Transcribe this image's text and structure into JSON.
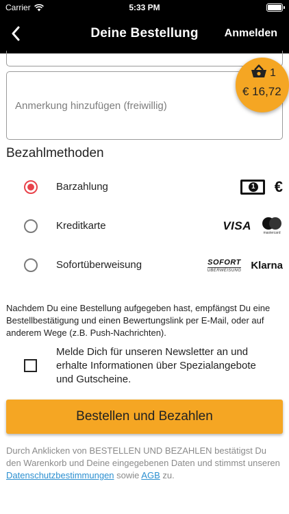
{
  "status_bar": {
    "carrier": "Carrier",
    "time": "5:33 PM"
  },
  "nav": {
    "title": "Deine Bestellung",
    "login": "Anmelden"
  },
  "basket": {
    "count": "1",
    "price": "€ 16,72"
  },
  "note_field": {
    "placeholder": "Anmerkung hinzufügen (freiwillig)"
  },
  "payment": {
    "title": "Bezahlmethoden",
    "methods": [
      {
        "label": "Barzahlung",
        "selected": true
      },
      {
        "label": "Kreditkarte",
        "selected": false
      },
      {
        "label": "Sofortüberweisung",
        "selected": false
      }
    ],
    "logos": {
      "euro": "€",
      "visa": "VISA",
      "mastercard": "mastercard",
      "sofort": "SOFORT",
      "sofort_sub": "ÜBERWEISUNG",
      "klarna": "Klarna"
    }
  },
  "info_text": "Nachdem Du eine Bestellung aufgegeben hast, empfängst Du eine Bestellbestätigung und einen Bewertungslink per E-Mail, oder auf anderem Wege (z.B. Push-Nachrichten).",
  "newsletter": {
    "label": "Melde Dich für unseren Newsletter an und erhalte Informationen über Spezialangebote und Gutscheine.",
    "checked": false
  },
  "order_button": "Bestellen und Bezahlen",
  "legal": {
    "text_before": "Durch Anklicken von BESTELLEN UND BEZAHLEN bestätigst Du den Warenkorb und Deine eingegebenen Daten und stimmst unseren ",
    "privacy_link": "Datenschutzbestimmungen",
    "text_middle": " sowie ",
    "terms_link": "AGB",
    "text_after": " zu."
  },
  "colors": {
    "accent": "#f5a623",
    "radio_selected": "#e8424a",
    "link": "#2b8fd0",
    "bar_background": "#000000"
  }
}
